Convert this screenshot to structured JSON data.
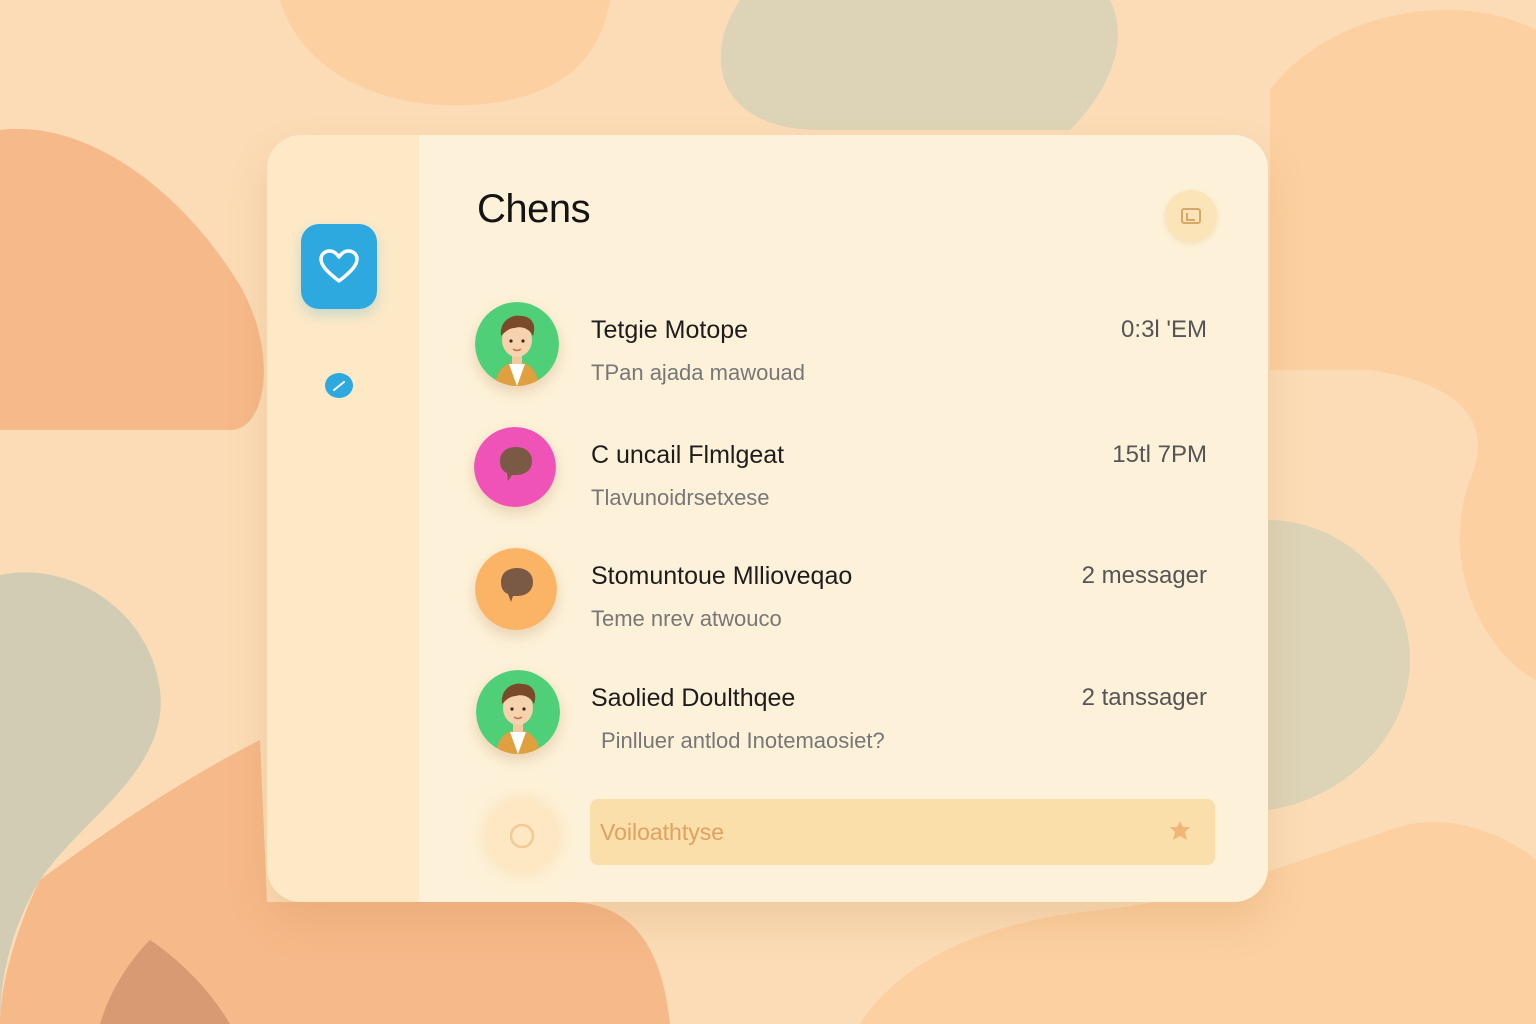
{
  "colors": {
    "background": "#fbdcb6",
    "card": "#fdf2d9",
    "sidebar": "#fde9c6",
    "accent": "#2ea9e0",
    "composer": "#fbdfab"
  },
  "sidebar": {
    "logo_icon": "heart-icon",
    "nav_icon": "check-icon"
  },
  "header": {
    "title": "Chens",
    "action_icon": "menu-icon"
  },
  "chats": [
    {
      "name": "Tetgie Motope",
      "preview": "TPan ajada mawouad",
      "meta": "0:3l 'EM",
      "avatar": "person-green"
    },
    {
      "name": "C uncail Flmlgeat",
      "preview": "Tlavunoidrsetxese",
      "meta": "15tl 7PM",
      "avatar": "chat-pink"
    },
    {
      "name": "Stomuntoue Mllioveqao",
      "preview": "Teme nrev atwouco",
      "meta": "2 messager",
      "avatar": "chat-orange"
    },
    {
      "name": "Saolied Doulthqee",
      "preview": "Pinlluer antlod Inotemaosiet?",
      "meta": "2 tanssager",
      "avatar": "person-green"
    }
  ],
  "composer": {
    "placeholder": "Voiloathtyse",
    "attach_icon": "circle-icon",
    "send_icon": "star-icon"
  }
}
